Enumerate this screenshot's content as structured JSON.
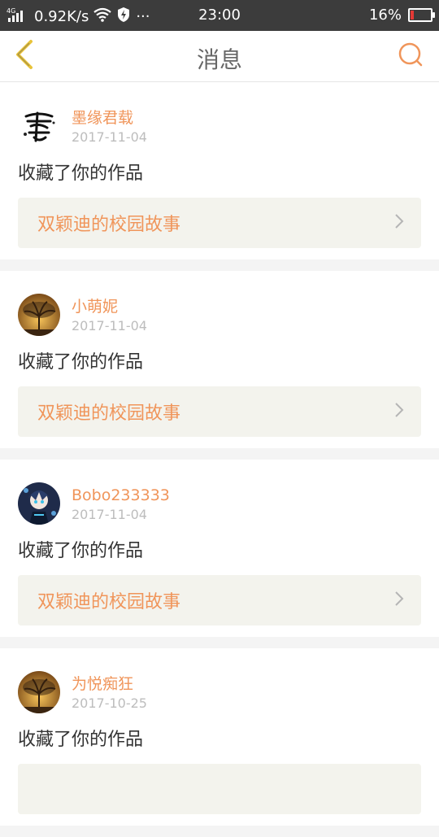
{
  "status_bar": {
    "network": "4G",
    "speed": "0.92K/s",
    "more": "···",
    "time": "23:00",
    "battery_percent": "16%",
    "battery_level": 0.16
  },
  "header": {
    "title": "消息",
    "back_icon": "chevron-left-icon",
    "search_icon": "search-icon"
  },
  "messages": [
    {
      "user": "墨缘君载",
      "date": "2017-11-04",
      "action": "收藏了你的作品",
      "work": "双颖迪的校园故事",
      "avatar_icon": "ink-calligraphy-avatar"
    },
    {
      "user": "小萌妮",
      "date": "2017-11-04",
      "action": "收藏了你的作品",
      "work": "双颖迪的校园故事",
      "avatar_icon": "tree-sunset-avatar"
    },
    {
      "user": "Bobo233333",
      "date": "2017-11-04",
      "action": "收藏了你的作品",
      "work": "双颖迪的校园故事",
      "avatar_icon": "anime-character-avatar"
    },
    {
      "user": "为悦痴狂",
      "date": "2017-10-25",
      "action": "收藏了你的作品",
      "work": "",
      "avatar_icon": "tree-sunset-avatar"
    }
  ],
  "colors": {
    "accent": "#f0955a",
    "statusbar_bg": "#3c3c3c",
    "card_link_bg": "#f3f3ed"
  }
}
